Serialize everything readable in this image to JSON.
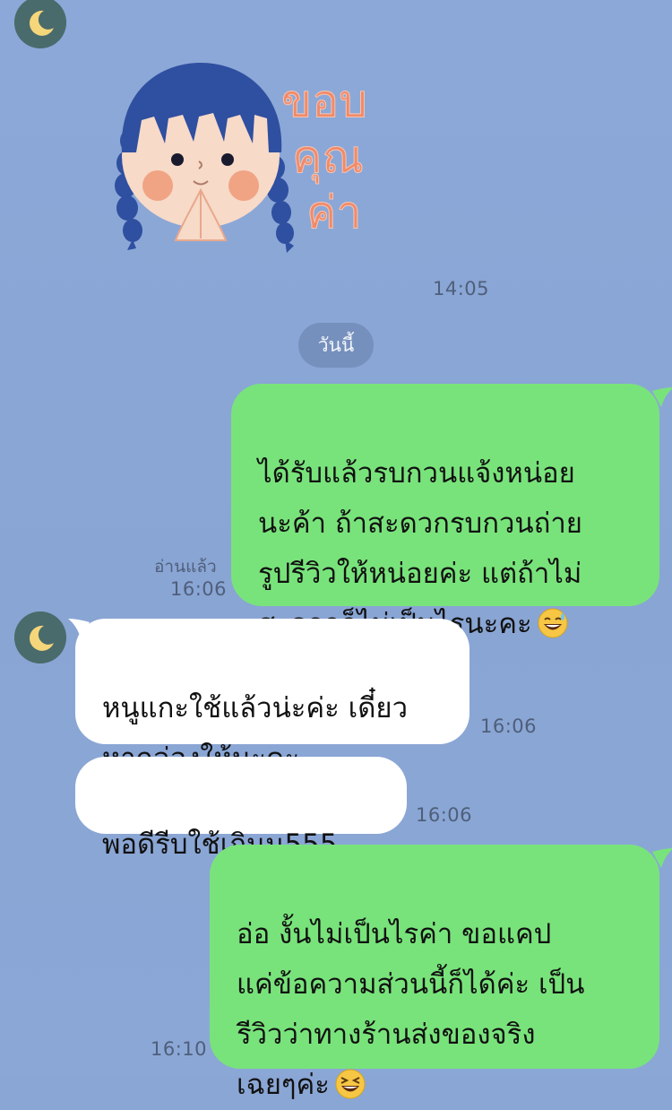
{
  "header_avatar": {
    "icon": "moon-icon"
  },
  "sticker": {
    "text_lines": [
      "ขอบ",
      "คุณ",
      "ค่า"
    ],
    "time": "14:05",
    "colors": {
      "hair": "#2f4fa0",
      "text": "#f08a6a",
      "skin": "#f7dac8"
    }
  },
  "date_divider": {
    "label": "วันนี้"
  },
  "messages": [
    {
      "side": "out",
      "text": "ได้รับแล้วรบกวนแจ้งหน่อย\nนะค้า ถ้าสะดวกรบกวนถ่าย\nรูปรีวิวให้หน่อยค่ะ แต่ถ้าไม่\nสะดวกก็ไม่เป็นไรนะคะ",
      "emoji": "grinning-sweat-emoji",
      "read_label": "อ่านแล้ว",
      "time": "16:06"
    },
    {
      "side": "in",
      "text": "หนูแกะใช้แล้วน่ะค่ะ เดี๋ยว\nหากล่องให้นะคะ",
      "time": "16:06"
    },
    {
      "side": "in",
      "text": "พอดีรีบใช้เกินน555",
      "time": "16:06"
    },
    {
      "side": "out",
      "text": "อ่อ งั้นไม่เป็นไรค่า ขอแคป\nแค่ข้อความส่วนนี้ก็ได้ค่ะ เป็น\nรีวิวว่าทางร้านส่งของจริง\nเฉยๆค่ะ",
      "emoji": "laughing-squint-emoji",
      "time": "16:10"
    }
  ],
  "colors": {
    "background": "#8aa6d5",
    "outgoing_bubble": "#79e37b",
    "incoming_bubble": "#ffffff",
    "avatar_bg": "#4a6b6c",
    "moon": "#f5d67a"
  }
}
